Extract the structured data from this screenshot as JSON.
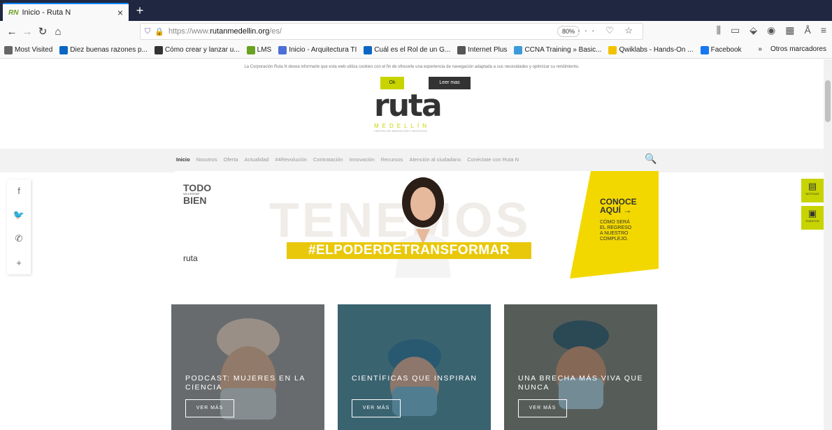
{
  "browser": {
    "tab_title": "Inicio - Ruta N",
    "tab_favicon": "RN",
    "url_prefix": "https://www.",
    "url_host": "rutanmedellin.org",
    "url_path": "/es/",
    "zoom": "80%",
    "url_dots": "···",
    "bookmarks": [
      {
        "label": "Most Visited",
        "color": "#666666"
      },
      {
        "label": "Diez buenas razones p...",
        "color": "#0a66c2"
      },
      {
        "label": "Cómo crear y lanzar u...",
        "color": "#333333"
      },
      {
        "label": "LMS",
        "color": "#6aa121"
      },
      {
        "label": "Inicio - Arquitectura TI",
        "color": "#4b6fd6"
      },
      {
        "label": "Cuál es el Rol de un G...",
        "color": "#0a66c2"
      },
      {
        "label": "Internet Plus",
        "color": "#555555"
      },
      {
        "label": "CCNA Training » Basic...",
        "color": "#3a9bd8"
      },
      {
        "label": "Qwiklabs - Hands-On ...",
        "color": "#f2c200"
      },
      {
        "label": "Facebook",
        "color": "#1877f2"
      }
    ],
    "other_bookmarks": "Otros marcadores",
    "more_symbol": "»"
  },
  "page": {
    "cookie_text": "La Corporación Ruta N desea informarle que esta web utiliza cookies con el fin de ofrecerle una experiencia de navegación adaptada a sus necesidades y optimizar su rendimiento.",
    "cookie_ok": "Ok",
    "cookie_more": "Leer mas",
    "logo_word": "ruta",
    "logo_city": "MEDELLÍN",
    "logo_sub": "CENTRO DE INNOVACIÓN Y NEGOCIOS",
    "menu": [
      "Inicio",
      "Nosotros",
      "Oferta",
      "Actualidad",
      "#4Revolución",
      "Contratación",
      "Innovación",
      "Recursos",
      "Atención al ciudadano",
      "Conéctate con Ruta N"
    ],
    "banner": {
      "todo_1": "TODO",
      "todo_small": "VA A ESTAR",
      "todo_2": "BIEN",
      "bg_word": "TENEMOS",
      "hashtag": "#ELPODERDETRANSFORMAR",
      "conoce": "CONOCE",
      "aqui": "AQUÍ →",
      "sub_1": "CÓMO SERÁ",
      "sub_2": "EL REGRESO",
      "sub_3": "A NUESTRO",
      "sub_4": "COMPLEJO.",
      "logos": "ruta"
    },
    "side_widgets": [
      {
        "label": "NOTICIAS",
        "icon": "newspaper-icon"
      },
      {
        "label": "EVENTOS",
        "icon": "calendar-icon"
      }
    ],
    "cards": [
      {
        "title": "PODCAST: MUJERES EN LA CIENCIA",
        "button": "VER MÁS"
      },
      {
        "title": "CIENTÍFICAS QUE INSPIRAN",
        "button": "VER MÁS"
      },
      {
        "title": "UNA BRECHA MÁS VIVA QUE NUNCA",
        "button": "VER MÁS"
      }
    ]
  }
}
